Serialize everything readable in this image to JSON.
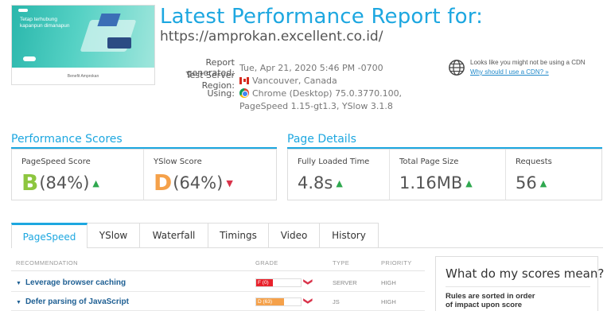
{
  "screenshot": {
    "hero_text": "Tetap terhubung kapanpun dimanapun",
    "bottom_title": "Benefit Amprokan"
  },
  "header": {
    "title": "Latest Performance Report for:",
    "url": "https://amprokan.excellent.co.id/"
  },
  "meta": {
    "generated_label": "Report generated:",
    "generated_value": "Tue, Apr 21, 2020 5:46 PM -0700",
    "region_label": "Test Server Region:",
    "region_value": "Vancouver, Canada",
    "region_icon": "canada-flag-icon",
    "using_label": "Using:",
    "using_value_1": "Chrome (Desktop) 75.0.3770.100,",
    "using_value_2": "PageSpeed 1.15-gt1.3, YSlow 3.1.8",
    "using_icon": "chrome-icon"
  },
  "cdn": {
    "text": "Looks like you might not be using a CDN",
    "link": "Why should I use a CDN? »"
  },
  "performance": {
    "title": "Performance Scores",
    "pagespeed_label": "PageSpeed Score",
    "pagespeed_grade": "B",
    "pagespeed_value": "(84%)",
    "yslow_label": "YSlow Score",
    "yslow_grade": "D",
    "yslow_value": "(64%)"
  },
  "details": {
    "title": "Page Details",
    "load_label": "Fully Loaded Time",
    "load_value": "4.8s",
    "size_label": "Total Page Size",
    "size_value": "1.16MB",
    "req_label": "Requests",
    "req_value": "56"
  },
  "tabs": [
    "PageSpeed",
    "YSlow",
    "Waterfall",
    "Timings",
    "Video",
    "History"
  ],
  "table": {
    "headers": {
      "recommendation": "RECOMMENDATION",
      "grade": "GRADE",
      "type": "TYPE",
      "priority": "PRIORITY"
    },
    "rows": [
      {
        "name": "Leverage browser caching",
        "grade": "F (0)",
        "score": 0,
        "type": "SERVER",
        "priority": "HIGH"
      },
      {
        "name": "Defer parsing of JavaScript",
        "grade": "D (63)",
        "score": 63,
        "type": "JS",
        "priority": "HIGH"
      }
    ]
  },
  "side": {
    "title": "What do my scores mean?",
    "text": "Rules are sorted in order of impact upon score"
  },
  "colors": {
    "accent": "#1da7e0",
    "grade_b": "#8dc63f",
    "grade_d": "#f5a14a",
    "grade_f": "#e8212b",
    "up": "#2fa84f",
    "down": "#d9334a"
  }
}
